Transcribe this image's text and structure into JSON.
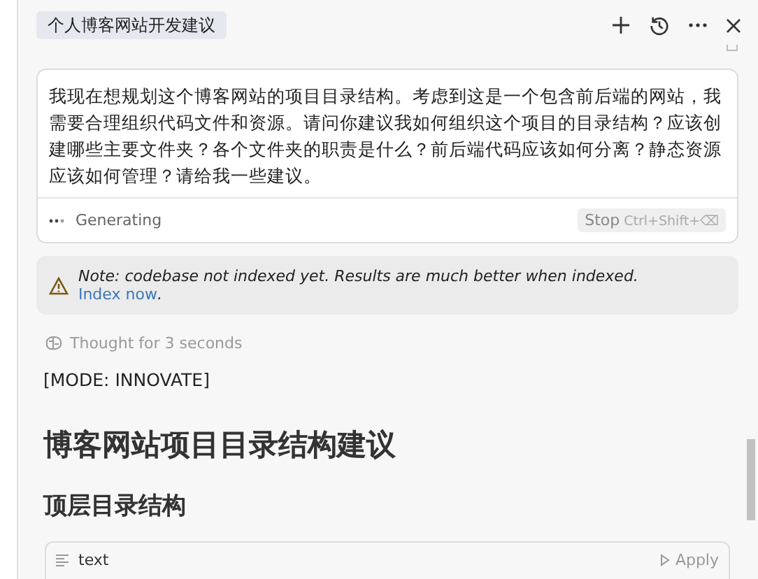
{
  "header": {
    "tab": "个人博客网站开发建议",
    "actions": [
      {
        "kind": "add"
      },
      {
        "kind": "history"
      },
      {
        "kind": "more"
      },
      {
        "kind": "close"
      }
    ]
  },
  "prompt": {
    "text": "我现在想规划这个博客网站的项目目录结构。考虑到这是一个包含前后端的网站，我需要合理组织代码文件和资源。请问你建议我如何组织这个项目的目录结构？应该创建哪些主要文件夹？各个文件夹的职责是什么？前后端代码应该如何分离？静态资源应该如何管理？请给我一些建议。",
    "status": "Generating",
    "stop": "Stop",
    "shortcut": "Ctrl+Shift+⌫"
  },
  "note": {
    "text": "Note: codebase not indexed yet. Results are much better when indexed.",
    "link": "Index now",
    "tail": "."
  },
  "response": {
    "thought": "Thought for 3 seconds",
    "mode": "[MODE: INNOVATE]",
    "heading": "博客网站项目目录结构建议",
    "subheading": "顶层目录结构",
    "code_block": {
      "language": "text",
      "apply": "Apply"
    }
  }
}
